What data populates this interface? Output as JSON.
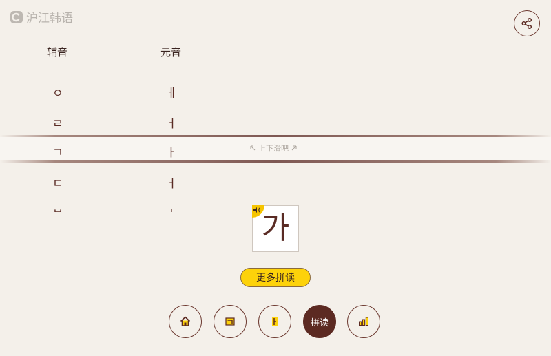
{
  "brand": {
    "logo_text": "沪江韩语"
  },
  "columns": {
    "consonant_header": "辅音",
    "vowel_header": "元音"
  },
  "consonants": [
    "ㅇ",
    "ㄹ",
    "ㄱ",
    "ㄷ",
    "ㅂ"
  ],
  "vowels": [
    "ㅔ",
    "ㅓ",
    "ㅏ",
    "ㅓ",
    "ㅗ"
  ],
  "swipe_hint": {
    "text": "上下滑吧"
  },
  "syllable": {
    "text": "가"
  },
  "more_button": {
    "label": "更多拼读"
  },
  "nav": {
    "home": "home-icon",
    "consonants": "consonant-icon",
    "vowels": "vowel-icon",
    "spelling_label": "拼读",
    "stats": "stats-icon"
  },
  "colors": {
    "background": "#f4f0ea",
    "brown": "#5c2a22",
    "yellow": "#fdd20a"
  }
}
